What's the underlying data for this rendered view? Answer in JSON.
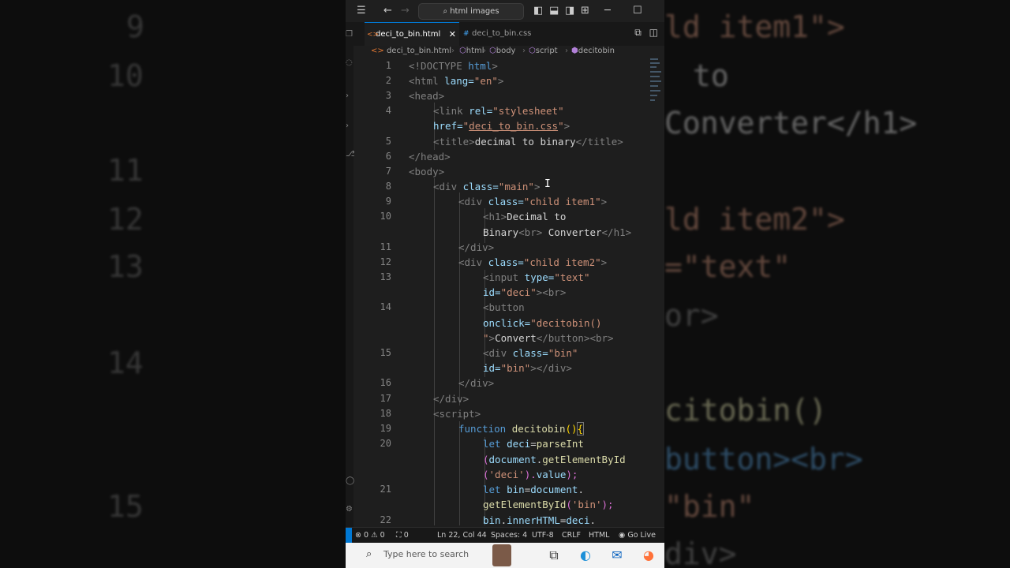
{
  "titlebar": {
    "search_text": "html images",
    "icons": [
      "menu-icon",
      "back-arrow-icon",
      "forward-arrow-icon",
      "search-icon",
      "layout-sidebar-icon",
      "layout-panel-icon",
      "layout-secondary-icon",
      "customize-layout-icon",
      "minimize-icon",
      "maximize-icon"
    ]
  },
  "tabs": [
    {
      "label": "deci_to_bin.html",
      "active": true
    },
    {
      "label": "deci_to_bin.css",
      "active": false
    }
  ],
  "breadcrumb": [
    "deci_to_bin.html",
    "html",
    "body",
    "script",
    "decitobin"
  ],
  "code_lines": [
    {
      "num": "1"
    },
    {
      "num": "2"
    },
    {
      "num": "3"
    },
    {
      "num": "4"
    },
    {
      "num": "5"
    },
    {
      "num": "6"
    },
    {
      "num": "7"
    },
    {
      "num": "8"
    },
    {
      "num": "9"
    },
    {
      "num": "10"
    },
    {
      "num": "11"
    },
    {
      "num": "12"
    },
    {
      "num": "13"
    },
    {
      "num": "14"
    },
    {
      "num": "15"
    },
    {
      "num": "16"
    },
    {
      "num": "17"
    },
    {
      "num": "18"
    },
    {
      "num": "19"
    },
    {
      "num": "20"
    },
    {
      "num": "21"
    },
    {
      "num": "22"
    }
  ],
  "code": {
    "l1": [
      "<!DOCTYPE",
      " html",
      ">"
    ],
    "l2": [
      "<html",
      " lang=",
      "\"en\"",
      ">"
    ],
    "l3": [
      "<head>"
    ],
    "l4a": [
      "<link",
      " rel=",
      "\"stylesheet\""
    ],
    "l4b": [
      "href=",
      "\"",
      "deci_to_bin.css",
      "\"",
      ">"
    ],
    "l5": [
      "<title>",
      "decimal to binary",
      "</title>"
    ],
    "l6": [
      "</head>"
    ],
    "l7": [
      "<body>"
    ],
    "l8": [
      "<div",
      " class=",
      "\"main\"",
      ">"
    ],
    "l9": [
      "<div",
      " class=",
      "\"child item1\"",
      ">"
    ],
    "l10a": [
      "<h1>",
      "Decimal to"
    ],
    "l10b": [
      "Binary",
      "<br>",
      " Converter",
      "</h1>"
    ],
    "l11": [
      "</div>"
    ],
    "l12": [
      "<div",
      " class=",
      "\"child item2\"",
      ">"
    ],
    "l13a": [
      "<input",
      " type=",
      "\"text\""
    ],
    "l13b": [
      "id=",
      "\"deci\"",
      "><br>"
    ],
    "l14a": [
      "<button"
    ],
    "l14b": [
      "onclick=",
      "\"decitobin()"
    ],
    "l14c": [
      "\"",
      ">",
      "Convert",
      "</button><br>"
    ],
    "l15a": [
      "<div",
      " class=",
      "\"bin\""
    ],
    "l15b": [
      "id=",
      "\"bin\"",
      "></div>"
    ],
    "l16": [
      "</div>"
    ],
    "l17": [
      "</div>"
    ],
    "l18": [
      "<script>"
    ],
    "l19": [
      "function",
      " decitobin",
      "()",
      "{"
    ],
    "l20a": [
      "let",
      " deci",
      "=",
      "parseInt"
    ],
    "l20b": [
      "(",
      "document",
      ".",
      "getElementById"
    ],
    "l20c": [
      "(",
      "'deci'",
      ").",
      "value",
      ");"
    ],
    "l21a": [
      "let",
      " bin",
      "=",
      "document",
      "."
    ],
    "l21b": [
      "getElementById",
      "(",
      "'bin'",
      ");"
    ],
    "l22": [
      "bin",
      ".",
      "innerHTML",
      "=",
      "deci",
      "."
    ]
  },
  "statusbar": {
    "errors": "0",
    "warnings": "0",
    "ports": "0",
    "position": "Ln 22, Col 44",
    "spaces": "Spaces: 4",
    "encoding": "UTF-8",
    "eol": "CRLF",
    "language": "HTML",
    "golive": "Go Live"
  },
  "taskbar": {
    "search_placeholder": "Type here to search",
    "icons": [
      "search-icon",
      "avatar-thumbnail",
      "task-view-icon",
      "edge-icon",
      "mail-icon",
      "firefox-icon"
    ]
  },
  "backdrop": {
    "left_numbers": [
      "9",
      "10",
      "11",
      "12",
      "13",
      "14",
      "15"
    ],
    "right_fragments": [
      "ld item1\">",
      "to",
      "Converter</h1>",
      "ld item2\">",
      "=\"text\"",
      "or>",
      "citobin()",
      "button><br>",
      "\"bin\"",
      "div>"
    ]
  }
}
